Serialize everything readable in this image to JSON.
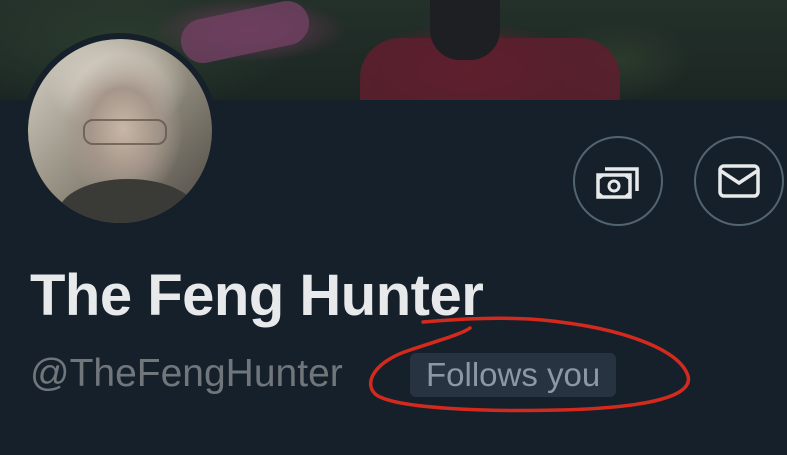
{
  "profile": {
    "display_name": "The Feng Hunter",
    "handle": "@TheFengHunter",
    "follows_you_badge": "Follows you"
  },
  "actions": {
    "tips_icon": "money-icon",
    "message_icon": "envelope-icon"
  },
  "colors": {
    "background": "#15202b",
    "name_text": "#e7e9ea",
    "handle_text": "#71767b",
    "badge_background": "#273340",
    "annotation_red": "#d42a1e"
  }
}
